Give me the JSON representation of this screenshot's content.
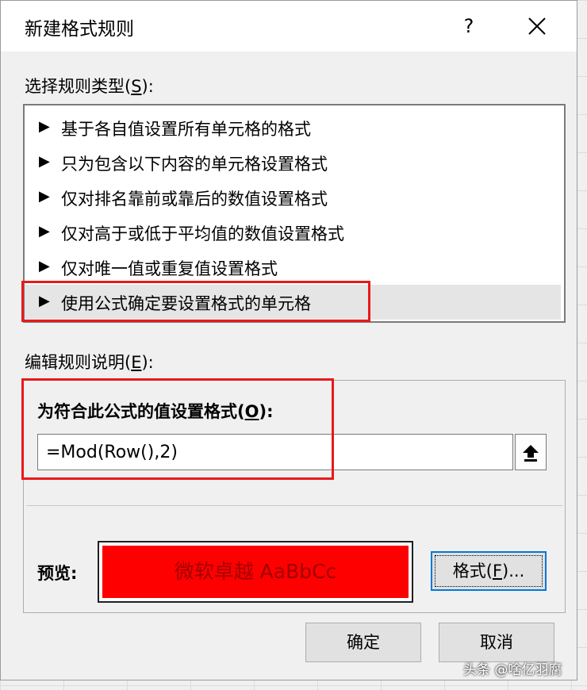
{
  "dialog": {
    "title": "新建格式规则",
    "help": "?"
  },
  "rule_type": {
    "label_prefix": "选择规则类型(",
    "label_key": "S",
    "label_suffix": "):",
    "arrow": "▶",
    "items": [
      {
        "label": "基于各自值设置所有单元格的格式",
        "selected": false
      },
      {
        "label": "只为包含以下内容的单元格设置格式",
        "selected": false
      },
      {
        "label": "仅对排名靠前或靠后的数值设置格式",
        "selected": false
      },
      {
        "label": "仅对高于或低于平均值的数值设置格式",
        "selected": false
      },
      {
        "label": "仅对唯一值或重复值设置格式",
        "selected": false
      },
      {
        "label": "使用公式确定要设置格式的单元格",
        "selected": true
      }
    ]
  },
  "rule_edit": {
    "label_prefix": "编辑规则说明(",
    "label_key": "E",
    "label_suffix": "):",
    "formula_label_prefix": "为符合此公式的值设置格式(",
    "formula_label_key": "O",
    "formula_label_suffix": "):",
    "formula_value": "=Mod(Row(),2)",
    "preview_label": "预览:",
    "preview_text": "微软卓越  AaBbCc",
    "preview_bg": "#fe0000",
    "format_button_prefix": "格式(",
    "format_button_key": "F",
    "format_button_suffix": ")..."
  },
  "footer": {
    "ok": "确定",
    "cancel": "取消"
  },
  "watermark": "头条 @啥亿羽腐",
  "colors": {
    "highlight": "#e8191b",
    "focus": "#0078d7"
  }
}
